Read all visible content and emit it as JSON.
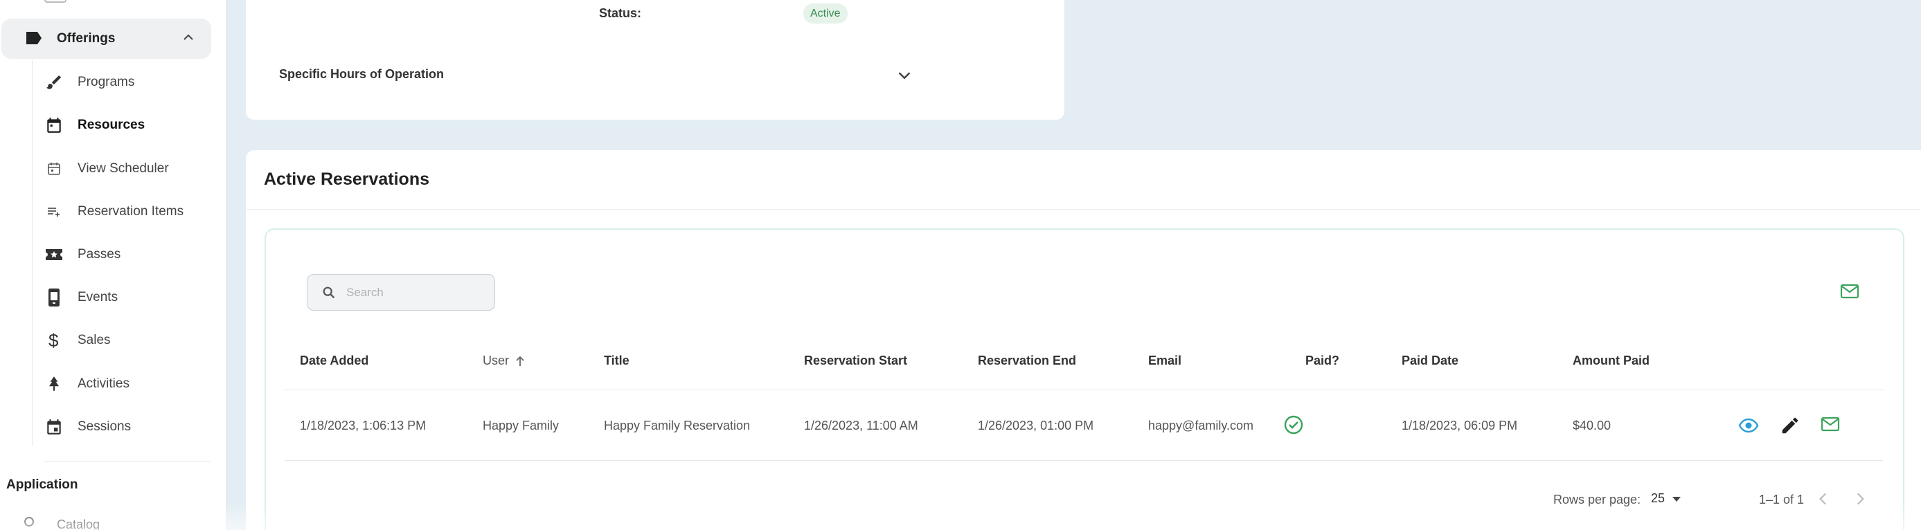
{
  "sidebar": {
    "offerings_label": "Offerings",
    "items": [
      {
        "label": "Programs",
        "icon": "brush-icon"
      },
      {
        "label": "Resources",
        "icon": "calendar-icon"
      },
      {
        "label": "View Scheduler",
        "icon": "calendar-outline-icon"
      },
      {
        "label": "Reservation Items",
        "icon": "playlist-add-icon"
      },
      {
        "label": "Passes",
        "icon": "ticket-icon"
      },
      {
        "label": "Events",
        "icon": "phone-icon"
      },
      {
        "label": "Sales",
        "icon": "dollar-icon"
      },
      {
        "label": "Activities",
        "icon": "tree-icon"
      },
      {
        "label": "Sessions",
        "icon": "event-icon"
      }
    ],
    "application_heading": "Application",
    "catalog_label": "Catalog"
  },
  "details": {
    "status_label": "Status:",
    "status_value": "Active",
    "hours_label": "Specific Hours of Operation"
  },
  "reservations": {
    "title": "Active Reservations",
    "search_placeholder": "Search",
    "columns": {
      "date_added": "Date Added",
      "user": "User",
      "title": "Title",
      "res_start": "Reservation Start",
      "res_end": "Reservation End",
      "email": "Email",
      "paid": "Paid?",
      "paid_date": "Paid Date",
      "amount_paid": "Amount Paid"
    },
    "rows": [
      {
        "date_added": "1/18/2023, 1:06:13 PM",
        "user": "Happy Family",
        "title": "Happy Family Reservation",
        "res_start": "1/26/2023, 11:00 AM",
        "res_end": "1/26/2023, 01:00 PM",
        "email": "happy@family.com",
        "paid": true,
        "paid_date": "1/18/2023, 06:09 PM",
        "amount_paid": "$40.00"
      }
    ],
    "pagination": {
      "rows_per_page_label": "Rows per page:",
      "rows_per_page": "25",
      "range": "1–1 of 1"
    }
  },
  "colors": {
    "accent_green": "#3aa35a",
    "view_blue": "#2a9fd8",
    "background": "#e3edf3"
  }
}
